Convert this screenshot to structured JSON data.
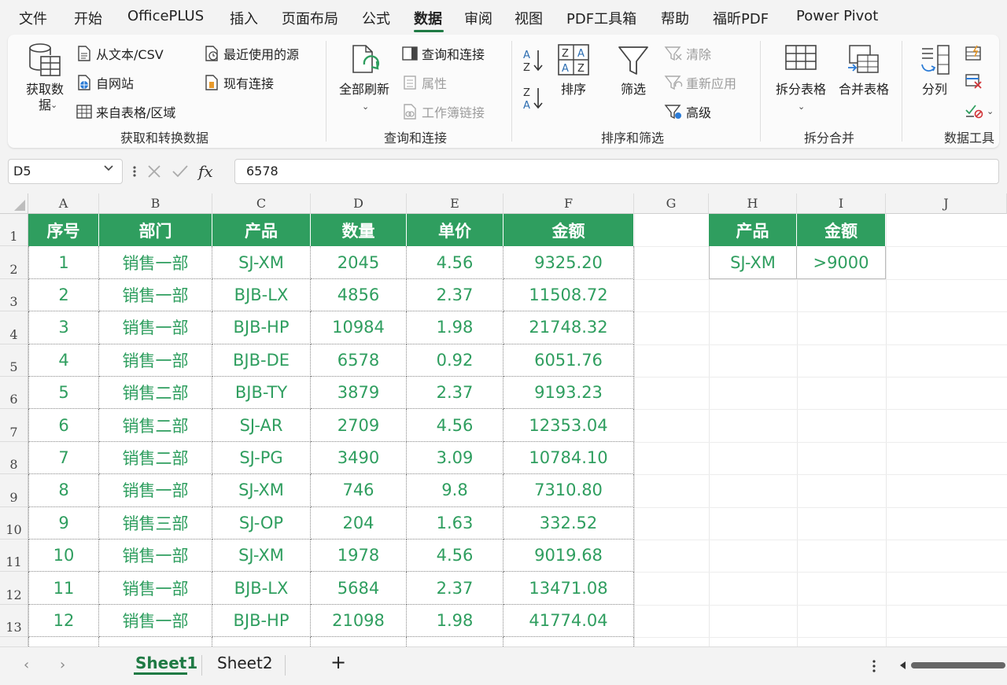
{
  "menu": {
    "items": [
      {
        "label": "文件"
      },
      {
        "label": "开始"
      },
      {
        "label": "OfficePLUS"
      },
      {
        "label": "插入"
      },
      {
        "label": "页面布局"
      },
      {
        "label": "公式"
      },
      {
        "label": "数据"
      },
      {
        "label": "审阅"
      },
      {
        "label": "视图"
      },
      {
        "label": "PDF工具箱"
      },
      {
        "label": "帮助"
      },
      {
        "label": "福昕PDF"
      },
      {
        "label": "Power Pivot"
      }
    ],
    "active_item": "数据"
  },
  "ribbon": {
    "get_data": "获取数\n据",
    "from_text": "从文本/CSV",
    "from_web": "自网站",
    "from_table": "来自表格/区域",
    "recent_sources": "最近使用的源",
    "existing_connections": "现有连接",
    "group_get_transform": "获取和转换数据",
    "refresh_all": "全部刷新",
    "queries_connections": "查询和连接",
    "properties": "属性",
    "workbook_links": "工作簿链接",
    "group_queries": "查询和连接",
    "sort": "排序",
    "filter": "筛选",
    "clear": "清除",
    "reapply": "重新应用",
    "advanced": "高级",
    "group_sort_filter": "排序和筛选",
    "split_table": "拆分表格",
    "merge_table": "合并表格",
    "group_split_merge": "拆分合并",
    "text_to_columns": "分列",
    "group_data_tools": "数据工具"
  },
  "formula_bar": {
    "name_box": "D5",
    "formula": "6578"
  },
  "columns": [
    "A",
    "B",
    "C",
    "D",
    "E",
    "F",
    "G",
    "H",
    "I",
    "J"
  ],
  "rows": [
    "1",
    "2",
    "3",
    "4",
    "5",
    "6",
    "7",
    "8",
    "9",
    "10",
    "11",
    "12",
    "13"
  ],
  "main_table": {
    "headers": [
      "序号",
      "部门",
      "产品",
      "数量",
      "单价",
      "金额"
    ],
    "rows": [
      [
        "1",
        "销售一部",
        "SJ-XM",
        "2045",
        "4.56",
        "9325.20"
      ],
      [
        "2",
        "销售一部",
        "BJB-LX",
        "4856",
        "2.37",
        "11508.72"
      ],
      [
        "3",
        "销售一部",
        "BJB-HP",
        "10984",
        "1.98",
        "21748.32"
      ],
      [
        "4",
        "销售一部",
        "BJB-DE",
        "6578",
        "0.92",
        "6051.76"
      ],
      [
        "5",
        "销售二部",
        "BJB-TY",
        "3879",
        "2.37",
        "9193.23"
      ],
      [
        "6",
        "销售二部",
        "SJ-AR",
        "2709",
        "4.56",
        "12353.04"
      ],
      [
        "7",
        "销售二部",
        "SJ-PG",
        "3490",
        "3.09",
        "10784.10"
      ],
      [
        "8",
        "销售一部",
        "SJ-XM",
        "746",
        "9.8",
        "7310.80"
      ],
      [
        "9",
        "销售三部",
        "SJ-OP",
        "204",
        "1.63",
        "332.52"
      ],
      [
        "10",
        "销售一部",
        "SJ-XM",
        "1978",
        "4.56",
        "9019.68"
      ],
      [
        "11",
        "销售一部",
        "BJB-LX",
        "5684",
        "2.37",
        "13471.08"
      ],
      [
        "12",
        "销售一部",
        "BJB-HP",
        "21098",
        "1.98",
        "41774.04"
      ]
    ]
  },
  "criteria_table": {
    "headers": [
      "产品",
      "金额"
    ],
    "values": [
      "SJ-XM",
      ">9000"
    ]
  },
  "sheets": [
    {
      "label": "Sheet1",
      "active": true
    },
    {
      "label": "Sheet2",
      "active": false
    }
  ],
  "add_sheet": "+",
  "colors": {
    "header_green": "#2f9e5f",
    "text_green": "#2f9e5f",
    "accent": "#1f7a44"
  }
}
